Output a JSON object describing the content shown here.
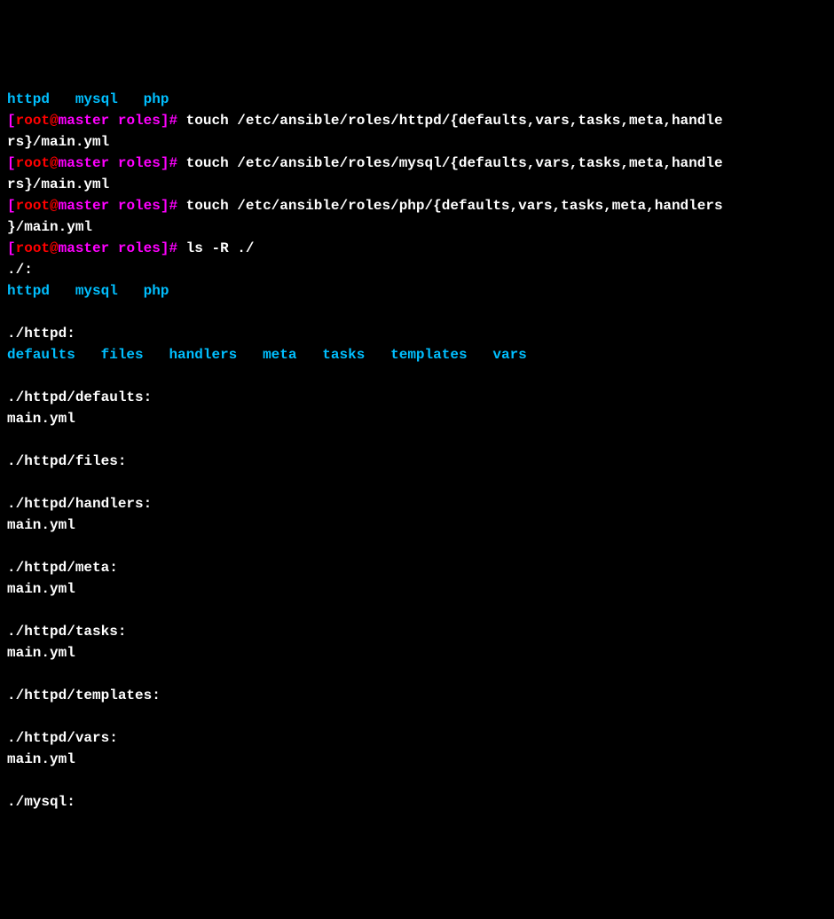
{
  "topLine": {
    "dir1": "httpd",
    "dir2": "mysql",
    "dir3": "php"
  },
  "prompt": {
    "openBracket": "[",
    "user": "root",
    "at": "@",
    "host": "master",
    "path": " roles",
    "closeBracket": "]",
    "hash": "#"
  },
  "commands": {
    "touch1a": " touch /etc/ansible/roles/httpd/{defaults,vars,tasks,meta,handle",
    "touch1b": "rs}/main.yml",
    "touch2a": " touch /etc/ansible/roles/mysql/{defaults,vars,tasks,meta,handle",
    "touch2b": "rs}/main.yml",
    "touch3a": " touch /etc/ansible/roles/php/{defaults,vars,tasks,meta,handlers",
    "touch3b": "}/main.yml",
    "ls": " ls -R ./"
  },
  "output": {
    "root": "./:",
    "rootDirs": {
      "d1": "httpd",
      "d2": "mysql",
      "d3": "php"
    },
    "httpdHeader": "./httpd:",
    "httpdDirs": {
      "d1": "defaults",
      "d2": "files",
      "d3": "handlers",
      "d4": "meta",
      "d5": "tasks",
      "d6": "templates",
      "d7": "vars"
    },
    "httpdDefaults": "./httpd/defaults:",
    "mainYml1": "main.yml",
    "httpdFiles": "./httpd/files:",
    "httpdHandlers": "./httpd/handlers:",
    "mainYml2": "main.yml",
    "httpdMeta": "./httpd/meta:",
    "mainYml3": "main.yml",
    "httpdTasks": "./httpd/tasks:",
    "mainYml4": "main.yml",
    "httpdTemplates": "./httpd/templates:",
    "httpdVars": "./httpd/vars:",
    "mainYml5": "main.yml",
    "mysqlHeader": "./mysql:"
  }
}
